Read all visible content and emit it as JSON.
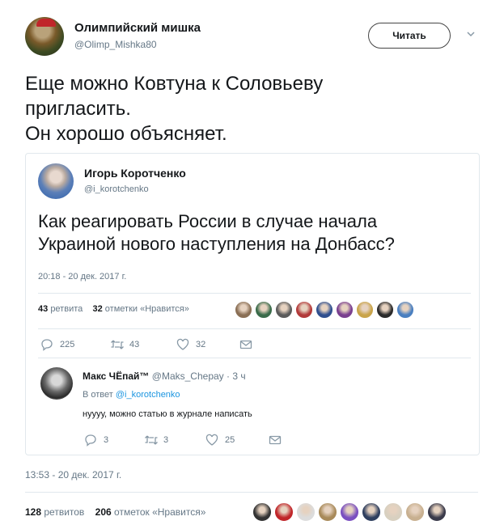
{
  "header": {
    "name": "Олимпийский мишка",
    "handle": "@Olimp_Mishka80",
    "follow_label": "Читать"
  },
  "tweet": {
    "lines": [
      "Еще можно Ковтуна к Соловьеву",
      "пригласить.",
      "Он хорошо объясняет."
    ]
  },
  "quoted": {
    "name": "Игорь Коротченко",
    "handle": "@i_korotchenko",
    "lines": [
      "Как реагировать России в случае начала",
      "Украиной нового наступления на Донбасс?"
    ],
    "timestamp": "20:18 - 20 дек. 2017 г.",
    "retweets_count": "43",
    "retweets_label": "ретвита",
    "likes_count": "32",
    "likes_label": "отметки «Нравится»",
    "liker_colors": [
      "#8a6f55",
      "#3a6b4a",
      "#5b5b5b",
      "#b23a3a",
      "#2f4f8f",
      "#7a3f8f",
      "#c9a44a",
      "#2a2a2a",
      "#4a7fc0"
    ],
    "actions": {
      "replies": "225",
      "retweets": "43",
      "likes": "32"
    },
    "reply": {
      "name": "Макс ЧЁпай™",
      "handle": "@Maks_Chepay",
      "time": "· 3 ч",
      "in_reply_label": "В ответ",
      "in_reply_handle": "@i_korotchenko",
      "text": "нуууу, можно статью в журнале написать",
      "actions": {
        "replies": "3",
        "retweets": "3",
        "likes": "25"
      }
    }
  },
  "footer": {
    "timestamp": "13:53 - 20 дек. 2017 г.",
    "retweets_count": "128",
    "retweets_label": "ретвитов",
    "likes_count": "206",
    "likes_label": "отметок «Нравится»",
    "liker_colors": [
      "#333333",
      "#c0262a",
      "#dcdcdc",
      "#a88a5a",
      "#7a4fc0",
      "#2f3f5f",
      "#d8d0c0",
      "#c8b090",
      "#3a3a4a"
    ]
  }
}
